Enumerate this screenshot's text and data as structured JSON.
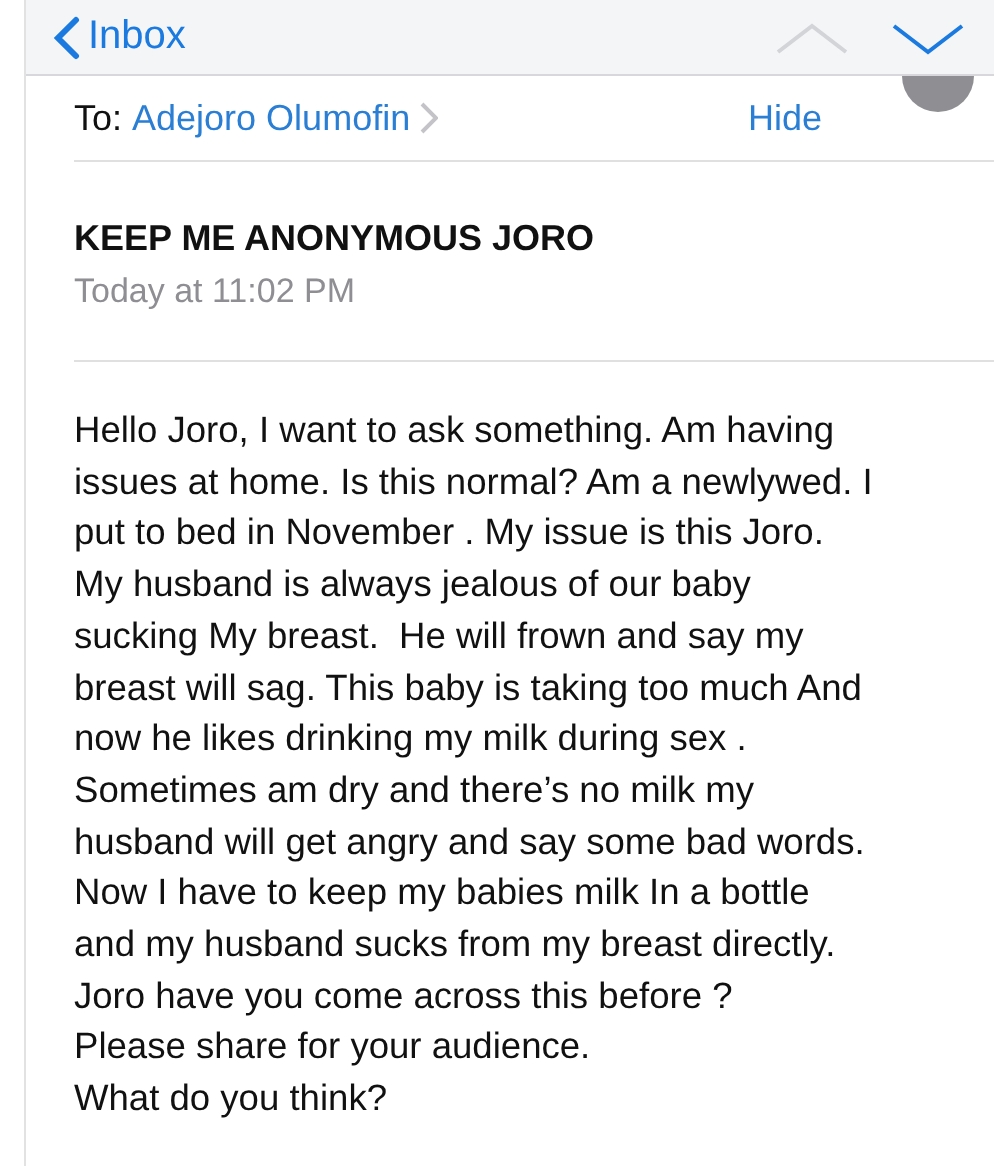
{
  "nav_bar": {
    "back_label": "Inbox",
    "previous_disabled": true,
    "next_disabled": false
  },
  "header": {
    "to_label": "To:",
    "recipient": "Adejoro Olumofin",
    "hide_label": "Hide"
  },
  "subject": "KEEP ME ANONYMOUS JORO",
  "date": "Today at 11:02 PM",
  "body_lines": [
    "Hello Joro, I want to ask something. Am having",
    "issues at home. Is this normal? Am a newlywed. I",
    "put to bed in November . My issue is this Joro.",
    "My husband is always jealous of our baby",
    "sucking My breast.  He will frown and say my",
    "breast will sag. This baby is taking too much And",
    "now he likes drinking my milk during sex .",
    "Sometimes am dry and there’s no milk my",
    "husband will get angry and say some bad words.",
    "Now I have to keep my babies milk In a bottle",
    "and my husband sucks from my breast directly.",
    "Joro have you come across this before ?",
    "Please share for your audience.",
    "What do you think?"
  ]
}
